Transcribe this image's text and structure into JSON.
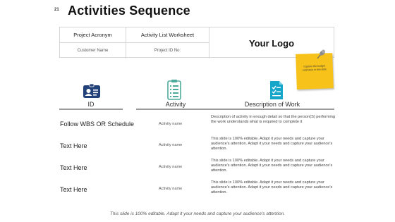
{
  "slide_number": "21",
  "title": "Activities Sequence",
  "info_table": {
    "project_acronym": "Project Acronym",
    "activity_list_worksheet": "Activity List Worksheet",
    "customer_name": "Customer Name",
    "project_id": "Project ID No:"
  },
  "logo_text": "Your Logo",
  "sticky_note": "Capture the budget estimates in this slide",
  "columns": {
    "id": "ID",
    "activity": "Activity",
    "description": "Description of Work"
  },
  "icons": {
    "id": "id-card-icon",
    "activity": "clipboard-icon",
    "description": "document-icon",
    "pin": "pushpin-icon"
  },
  "colors": {
    "navy": "#24427a",
    "teal": "#4cab9a",
    "cyan": "#16a6c9",
    "sticky": "#f7c21a"
  },
  "rows": [
    {
      "id": "Follow WBS OR Schedule",
      "activity": "Activity name",
      "description": "Description of activity in enough detail so that the person(S) performing the work understands what is required to complete it"
    },
    {
      "id": "Text Here",
      "activity": "Activity name",
      "description": "This slide is 100% editable. Adapt it your needs and capture your audience's attention. Adapt it your needs and capture your audience's attention."
    },
    {
      "id": "Text Here",
      "activity": "Activity name",
      "description": "This slide is 100% editable. Adapt it your needs and capture your audience's attention. Adapt it your needs and capture your audience's attention."
    },
    {
      "id": "Text Here",
      "activity": "Activity name",
      "description": "This slide is 100% editable. Adapt it your needs and capture your audience's attention. Adapt it your needs and capture your audience's attention."
    }
  ],
  "footer": "This slide is 100% editable. Adapt it your needs and capture your audience's attention."
}
